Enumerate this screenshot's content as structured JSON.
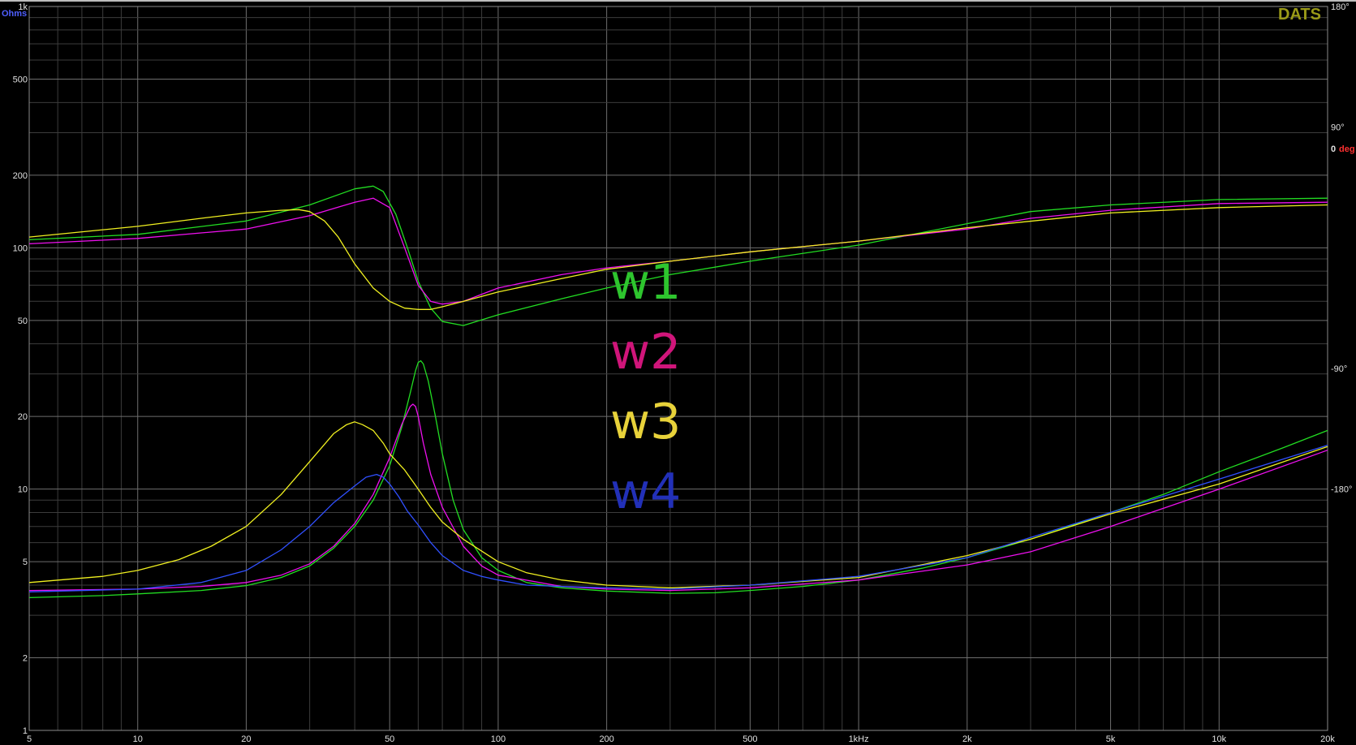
{
  "chart_data": {
    "type": "line",
    "brand": "DATS",
    "x_scale": "log",
    "xlim": [
      5,
      20000
    ],
    "x_ticks": [
      5,
      10,
      20,
      50,
      100,
      200,
      500,
      1000,
      2000,
      5000,
      10000,
      20000
    ],
    "x_tick_labels": [
      "5",
      "10",
      "20",
      "50",
      "100",
      "200",
      "500",
      "1kHz",
      "2k",
      "5k",
      "10k",
      "20k"
    ],
    "y_left": {
      "unit_label": "Ohms",
      "scale": "log",
      "lim": [
        1,
        1000
      ],
      "ticks": [
        1,
        2,
        5,
        10,
        20,
        50,
        100,
        200,
        500,
        1000
      ],
      "tick_labels": [
        "1",
        "2",
        "5",
        "10",
        "20",
        "50",
        "100",
        "200",
        "500",
        "1k"
      ],
      "unit_color": "#4f5fff"
    },
    "y_right": {
      "unit_label": "deg",
      "zero_label": "0",
      "lim": [
        -360,
        180
      ],
      "ticks": [
        180,
        90,
        -90,
        -180
      ],
      "tick_labels": [
        "180°",
        "90°",
        "-90°",
        "-180°"
      ],
      "unit_color": "#ff3030"
    },
    "grid": true,
    "legend_position": "center",
    "series": [
      {
        "name": "w1",
        "color": "#22dd22",
        "impedance": {
          "x": [
            5,
            8,
            10,
            15,
            20,
            25,
            30,
            35,
            40,
            45,
            50,
            54,
            57,
            59,
            60,
            61,
            62,
            64,
            67,
            70,
            75,
            80,
            90,
            100,
            120,
            150,
            200,
            300,
            400,
            500,
            700,
            1000,
            1500,
            2000,
            3000,
            5000,
            7000,
            10000,
            15000,
            20000
          ],
          "y": [
            3.55,
            3.62,
            3.68,
            3.8,
            3.98,
            4.3,
            4.8,
            5.7,
            7.0,
            9.0,
            12.5,
            18.0,
            25.0,
            31.0,
            33.5,
            34.0,
            33.0,
            28.0,
            20.0,
            14.0,
            9.0,
            6.8,
            5.2,
            4.6,
            4.1,
            3.9,
            3.78,
            3.7,
            3.72,
            3.8,
            3.95,
            4.2,
            4.7,
            5.2,
            6.2,
            8.0,
            9.5,
            11.8,
            14.8,
            17.5
          ]
        },
        "phase": {
          "x": [
            5,
            10,
            20,
            30,
            40,
            45,
            48,
            52,
            56,
            60,
            65,
            70,
            80,
            100,
            150,
            200,
            300,
            500,
            1000,
            2000,
            3000,
            5000,
            10000,
            20000
          ],
          "y": [
            6,
            10,
            20,
            32,
            44,
            46,
            42,
            25,
            0,
            -25,
            -45,
            -55,
            -58,
            -50,
            -38,
            -30,
            -20,
            -10,
            2,
            18,
            27,
            32,
            36,
            37
          ]
        }
      },
      {
        "name": "w2",
        "color": "#ee10ee",
        "impedance": {
          "x": [
            5,
            10,
            15,
            20,
            25,
            30,
            35,
            40,
            45,
            50,
            54,
            57,
            58,
            59,
            60,
            62,
            65,
            70,
            80,
            90,
            100,
            150,
            200,
            300,
            500,
            1000,
            2000,
            3000,
            5000,
            10000,
            20000
          ],
          "y": [
            3.8,
            3.85,
            3.95,
            4.1,
            4.4,
            4.9,
            5.8,
            7.2,
            9.5,
            13.5,
            18.5,
            22.0,
            22.5,
            22.0,
            20.0,
            15.5,
            11.5,
            8.4,
            5.8,
            4.8,
            4.4,
            3.95,
            3.85,
            3.8,
            3.9,
            4.2,
            4.85,
            5.5,
            7.0,
            10.0,
            14.5
          ]
        },
        "phase": {
          "x": [
            5,
            10,
            20,
            30,
            40,
            45,
            50,
            55,
            60,
            65,
            70,
            80,
            100,
            150,
            200,
            300,
            500,
            1000,
            2000,
            3000,
            5000,
            10000,
            20000
          ],
          "y": [
            3,
            7,
            14,
            24,
            34,
            37,
            30,
            0,
            -28,
            -40,
            -42,
            -40,
            -30,
            -20,
            -15,
            -10,
            -3,
            5,
            14,
            22,
            28,
            33,
            34
          ]
        }
      },
      {
        "name": "w3",
        "color": "#f0f020",
        "impedance": {
          "x": [
            5,
            8,
            10,
            13,
            16,
            20,
            25,
            30,
            35,
            38,
            40,
            42,
            45,
            48,
            50,
            55,
            60,
            65,
            70,
            80,
            100,
            120,
            150,
            200,
            300,
            500,
            1000,
            2000,
            3000,
            5000,
            10000,
            20000
          ],
          "y": [
            4.1,
            4.35,
            4.6,
            5.1,
            5.8,
            7.0,
            9.5,
            13.0,
            17.0,
            18.5,
            19.0,
            18.5,
            17.5,
            15.5,
            14.0,
            12.0,
            10.0,
            8.4,
            7.3,
            6.2,
            5.0,
            4.5,
            4.2,
            4.0,
            3.9,
            4.0,
            4.3,
            5.3,
            6.2,
            7.9,
            10.5,
            15.0
          ]
        },
        "phase": {
          "x": [
            5,
            10,
            15,
            20,
            25,
            28,
            30,
            33,
            36,
            40,
            45,
            50,
            55,
            60,
            65,
            70,
            80,
            100,
            150,
            200,
            300,
            500,
            1000,
            2000,
            5000,
            10000,
            20000
          ],
          "y": [
            8,
            16,
            22,
            26,
            28,
            28.5,
            27,
            20,
            8,
            -12,
            -30,
            -40,
            -45,
            -46,
            -46,
            -44,
            -40,
            -33,
            -23,
            -16,
            -10,
            -3,
            5,
            15,
            26,
            30,
            32
          ]
        }
      },
      {
        "name": "w4",
        "color": "#3050ff",
        "impedance": {
          "x": [
            5,
            10,
            15,
            20,
            25,
            30,
            35,
            40,
            43,
            46,
            48,
            50,
            53,
            56,
            60,
            65,
            70,
            80,
            90,
            100,
            120,
            150,
            200,
            300,
            500,
            1000,
            2000,
            3000,
            5000,
            10000,
            20000
          ],
          "y": [
            3.75,
            3.85,
            4.1,
            4.6,
            5.6,
            7.0,
            8.8,
            10.3,
            11.2,
            11.5,
            11.2,
            10.5,
            9.3,
            8.1,
            7.1,
            6.0,
            5.3,
            4.6,
            4.35,
            4.2,
            4.0,
            3.95,
            3.9,
            3.85,
            4.0,
            4.35,
            5.2,
            6.3,
            8.0,
            11.0,
            15.2
          ]
        },
        "phase": {
          "x": [],
          "y": []
        }
      }
    ]
  }
}
